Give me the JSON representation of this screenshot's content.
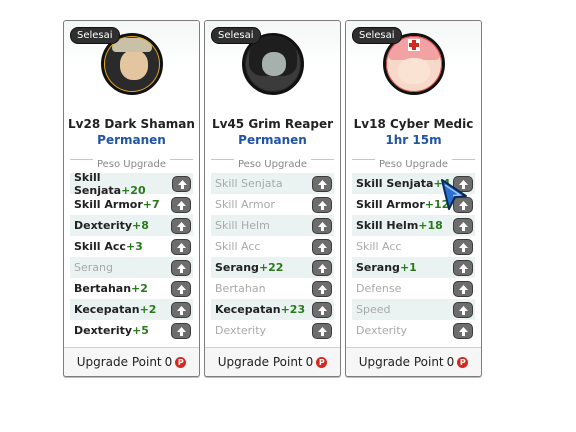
{
  "cards": [
    {
      "badge": "Selesai",
      "avatar_icon": "dark-shaman-portrait",
      "title": "Lv28 Dark Shaman",
      "subtitle": "Permanen",
      "section_label": "Peso Upgrade",
      "stats": [
        {
          "label": "Skill Senjata",
          "value": "+20",
          "active": true
        },
        {
          "label": "Skill Armor",
          "value": "+7",
          "active": true
        },
        {
          "label": "Dexterity",
          "value": "+8",
          "active": true
        },
        {
          "label": "Skill Acc",
          "value": "+3",
          "active": true
        },
        {
          "label": "Serang",
          "value": "",
          "active": false
        },
        {
          "label": "Bertahan",
          "value": "+2",
          "active": true
        },
        {
          "label": "Kecepatan",
          "value": "+2",
          "active": true
        },
        {
          "label": "Dexterity",
          "value": "+5",
          "active": true
        }
      ],
      "footer_label": "Upgrade Point",
      "footer_value": "0",
      "footer_icon": "P"
    },
    {
      "badge": "Selesai",
      "avatar_icon": "grim-reaper-portrait",
      "title": "Lv45 Grim Reaper",
      "subtitle": "Permanen",
      "section_label": "Peso Upgrade",
      "stats": [
        {
          "label": "Skill Senjata",
          "value": "",
          "active": false
        },
        {
          "label": "Skill Armor",
          "value": "",
          "active": false
        },
        {
          "label": "Skill Helm",
          "value": "",
          "active": false
        },
        {
          "label": "Skill Acc",
          "value": "",
          "active": false
        },
        {
          "label": "Serang",
          "value": "+22",
          "active": true
        },
        {
          "label": "Bertahan",
          "value": "",
          "active": false
        },
        {
          "label": "Kecepatan",
          "value": "+23",
          "active": true
        },
        {
          "label": "Dexterity",
          "value": "",
          "active": false
        }
      ],
      "footer_label": "Upgrade Point",
      "footer_value": "0",
      "footer_icon": "P"
    },
    {
      "badge": "Selesai",
      "avatar_icon": "cyber-medic-portrait",
      "title": "Lv18 Cyber Medic",
      "subtitle": "1hr 15m",
      "section_label": "Peso Upgrade",
      "stats": [
        {
          "label": "Skill Senjata",
          "value": "+4",
          "active": true
        },
        {
          "label": "Skill Armor",
          "value": "+12",
          "active": true
        },
        {
          "label": "Skill Helm",
          "value": "+18",
          "active": true
        },
        {
          "label": "Skill Acc",
          "value": "",
          "active": false
        },
        {
          "label": "Serang",
          "value": "+1",
          "active": true
        },
        {
          "label": "Defense",
          "value": "",
          "active": false
        },
        {
          "label": "Speed",
          "value": "",
          "active": false
        },
        {
          "label": "Dexterity",
          "value": "",
          "active": false
        }
      ],
      "footer_label": "Upgrade Point",
      "footer_value": "0",
      "footer_icon": "P"
    }
  ],
  "colors": {
    "subtitle": "#2154a6",
    "stat_value": "#2a7a1c",
    "dim_text": "#a9a9a9",
    "row_alt": "#eaf3f2",
    "point_icon": "#d2281f"
  }
}
